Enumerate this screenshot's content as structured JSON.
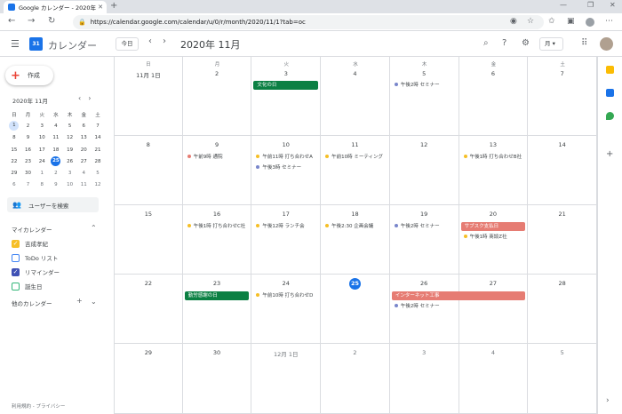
{
  "browser": {
    "tab_title": "Google カレンダー - 2020年 11月",
    "url": "https://calendar.google.com/calendar/u/0/r/month/2020/11/1?tab=oc"
  },
  "header": {
    "app_name": "カレンダー",
    "logo_text": "31",
    "today_label": "今日",
    "month_label": "2020年 11月",
    "view_label": "月"
  },
  "sidebar": {
    "create_label": "作成",
    "mini_month": "2020年 11月",
    "weekdays": [
      "日",
      "月",
      "火",
      "水",
      "木",
      "金",
      "土"
    ],
    "mini_weeks": [
      [
        "1",
        "2",
        "3",
        "4",
        "5",
        "6",
        "7"
      ],
      [
        "8",
        "9",
        "10",
        "11",
        "12",
        "13",
        "14"
      ],
      [
        "15",
        "16",
        "17",
        "18",
        "19",
        "20",
        "21"
      ],
      [
        "22",
        "23",
        "24",
        "25",
        "26",
        "27",
        "28"
      ],
      [
        "29",
        "30",
        "1",
        "2",
        "3",
        "4",
        "5"
      ],
      [
        "6",
        "7",
        "8",
        "9",
        "10",
        "11",
        "12"
      ]
    ],
    "search_users": "ユーザーを検索",
    "my_calendars_label": "マイカレンダー",
    "my_calendars": [
      {
        "name": "吉成孝紀",
        "color": "#f6bf26",
        "checked": true
      },
      {
        "name": "ToDo リスト",
        "color": "#4285f4",
        "checked": false
      },
      {
        "name": "リマインダー",
        "color": "#3f51b5",
        "checked": true
      },
      {
        "name": "誕生日",
        "color": "#33b679",
        "checked": false
      }
    ],
    "other_calendars_label": "他のカレンダー",
    "footer": "利用規約 - プライバシー"
  },
  "grid": {
    "weekdays": [
      "日",
      "月",
      "火",
      "水",
      "木",
      "金",
      "土"
    ],
    "first_day_label": "11月 1日",
    "weeks": [
      [
        "11月 1日",
        "2",
        "3",
        "4",
        "5",
        "6",
        "7"
      ],
      [
        "8",
        "9",
        "10",
        "11",
        "12",
        "13",
        "14"
      ],
      [
        "15",
        "16",
        "17",
        "18",
        "19",
        "20",
        "21"
      ],
      [
        "22",
        "23",
        "24",
        "25",
        "26",
        "27",
        "28"
      ],
      [
        "29",
        "30",
        "12月 1日",
        "2",
        "3",
        "4",
        "5"
      ]
    ],
    "today": "25",
    "events": [
      {
        "week": 0,
        "day": 2,
        "type": "bar",
        "text": "文化の日",
        "color": "#0b8043"
      },
      {
        "week": 0,
        "day": 4,
        "type": "dot",
        "text": "午後2時 セミナー",
        "color": "#7986cb"
      },
      {
        "week": 1,
        "day": 1,
        "type": "dot",
        "text": "午前9時 通院",
        "color": "#e67c73"
      },
      {
        "week": 1,
        "day": 2,
        "type": "dot",
        "text": "午前11時 打ち合わせA",
        "color": "#f6bf26"
      },
      {
        "week": 1,
        "day": 2,
        "type": "dot",
        "text": "午後3時 セミナー",
        "color": "#7986cb",
        "row": 1
      },
      {
        "week": 1,
        "day": 3,
        "type": "dot",
        "text": "午前10時 ミーティング",
        "color": "#f6bf26"
      },
      {
        "week": 1,
        "day": 5,
        "type": "dot",
        "text": "午後1時 打ち合わせB社",
        "color": "#f6bf26"
      },
      {
        "week": 2,
        "day": 1,
        "type": "dot",
        "text": "午後1時 打ち合わせC社",
        "color": "#f6bf26"
      },
      {
        "week": 2,
        "day": 2,
        "type": "dot",
        "text": "午後12時 ランチ会",
        "color": "#f6bf26"
      },
      {
        "week": 2,
        "day": 3,
        "type": "dot",
        "text": "午後2:30 企画会議",
        "color": "#f6bf26"
      },
      {
        "week": 2,
        "day": 4,
        "type": "dot",
        "text": "午後2時 セミナー",
        "color": "#7986cb"
      },
      {
        "week": 2,
        "day": 5,
        "type": "bar",
        "text": "サブスク支払日",
        "color": "#e67c73"
      },
      {
        "week": 2,
        "day": 5,
        "type": "dot",
        "text": "午後1時 商談Z社",
        "color": "#f6bf26",
        "row": 1
      },
      {
        "week": 3,
        "day": 1,
        "type": "bar",
        "text": "勤労感謝の日",
        "color": "#0b8043"
      },
      {
        "week": 3,
        "day": 2,
        "type": "dot",
        "text": "午前10時 打ち合わせD",
        "color": "#f6bf26"
      },
      {
        "week": 3,
        "day": 4,
        "type": "bar",
        "text": "インターネット工事",
        "color": "#e67c73",
        "span": 2
      },
      {
        "week": 3,
        "day": 4,
        "type": "dot",
        "text": "午後2時 セミナー",
        "color": "#7986cb",
        "row": 1
      }
    ]
  },
  "rightrail": [
    {
      "name": "keep-icon",
      "color": "#fbbc04"
    },
    {
      "name": "tasks-icon",
      "color": "#1a73e8"
    },
    {
      "name": "maps-icon",
      "color": "#34a853"
    }
  ]
}
